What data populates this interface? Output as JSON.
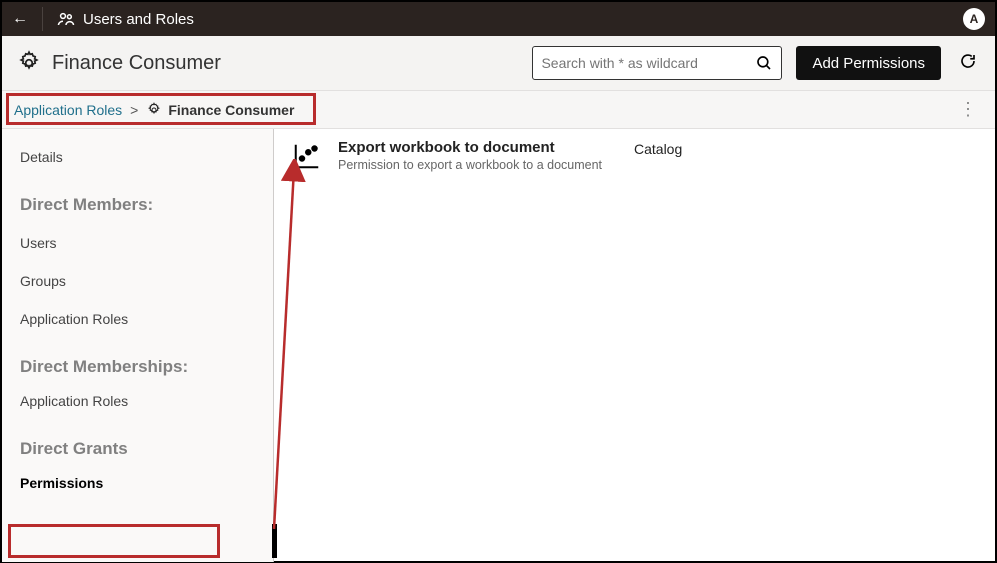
{
  "topbar": {
    "title": "Users and Roles",
    "avatar_initial": "A"
  },
  "header": {
    "role_name": "Finance Consumer",
    "search_placeholder": "Search with * as wildcard",
    "add_button": "Add Permissions"
  },
  "breadcrumb": {
    "link": "Application Roles",
    "separator": ">",
    "current": "Finance Consumer"
  },
  "sidebar": {
    "details": "Details",
    "section_members": "Direct Members:",
    "users": "Users",
    "groups": "Groups",
    "app_roles": "Application Roles",
    "section_memberships": "Direct Memberships:",
    "app_roles2": "Application Roles",
    "section_grants": "Direct Grants",
    "permissions": "Permissions"
  },
  "permission": {
    "title": "Export workbook to document",
    "description": "Permission to export a workbook to a document",
    "category": "Catalog"
  },
  "annotation": {
    "highlight_color": "#b82c2c"
  }
}
